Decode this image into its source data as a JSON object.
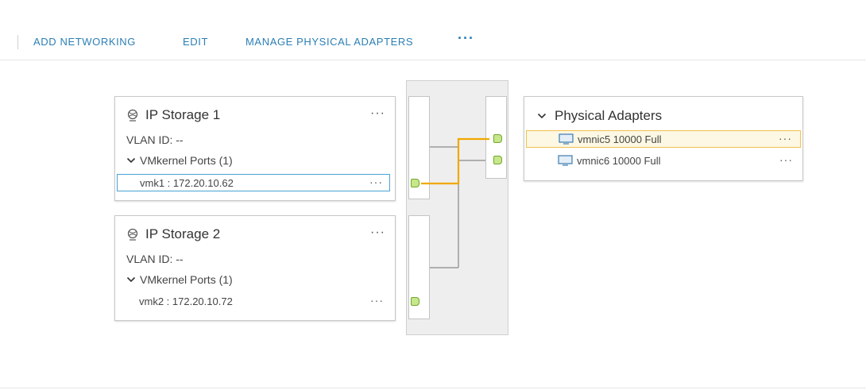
{
  "toolbar": {
    "add_networking": "ADD NETWORKING",
    "edit": "EDIT",
    "manage_adapters": "MANAGE PHYSICAL ADAPTERS",
    "more": "···"
  },
  "port_groups": [
    {
      "title": "IP Storage 1",
      "vlan": "VLAN ID: --",
      "ports": "VMkernel Ports (1)",
      "vmk": "vmk1 : 172.20.10.62",
      "selected": true
    },
    {
      "title": "IP Storage 2",
      "vlan": "VLAN ID: --",
      "ports": "VMkernel Ports (1)",
      "vmk": "vmk2 : 172.20.10.72",
      "selected": false
    }
  ],
  "physical_adapters": {
    "title": "Physical Adapters",
    "items": [
      {
        "label": "vmnic5 10000 Full",
        "selected": true
      },
      {
        "label": "vmnic6 10000 Full",
        "selected": false
      }
    ]
  },
  "more_glyph": "···",
  "colors": {
    "accent": "#2b7fb5",
    "highlight_path": "#f0a800",
    "port_fill": "#c8e68a",
    "selected_border": "#49a3d3",
    "adapter_selected_bg": "#fdf8e3"
  }
}
